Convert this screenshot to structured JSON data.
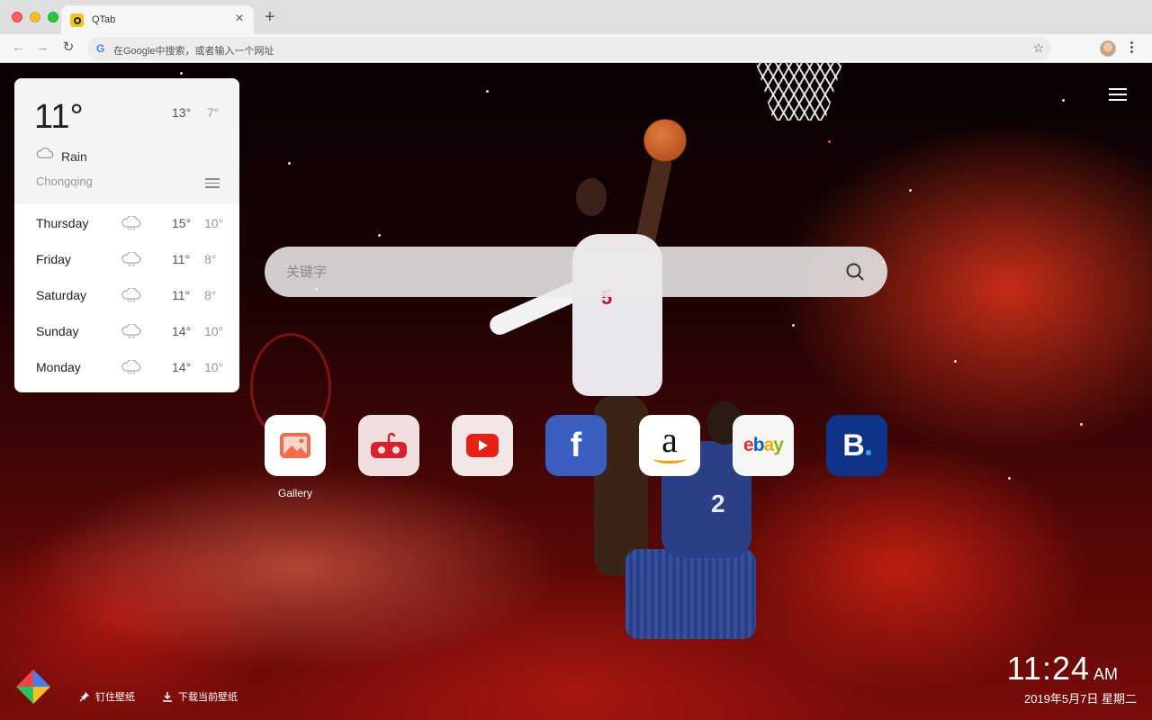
{
  "browser": {
    "tab_title": "QTab",
    "tab_close": "×",
    "new_tab": "+",
    "omnibox_placeholder": "在Google中搜索，或者输入一个网址",
    "back": "←",
    "forward": "→",
    "reload": "↻",
    "star": "☆"
  },
  "weather": {
    "current_temp": "11°",
    "high": "13°",
    "low": "7°",
    "condition": "Rain",
    "city": "Chongqing",
    "forecast": [
      {
        "day": "Thursday",
        "high": "15°",
        "low": "10°"
      },
      {
        "day": "Friday",
        "high": "11°",
        "low": "8°"
      },
      {
        "day": "Saturday",
        "high": "11°",
        "low": "8°"
      },
      {
        "day": "Sunday",
        "high": "14°",
        "low": "10°"
      },
      {
        "day": "Monday",
        "high": "14°",
        "low": "10°"
      }
    ]
  },
  "search": {
    "placeholder": "关键字"
  },
  "shortcuts": [
    {
      "name": "gallery",
      "label": "Gallery",
      "icon": "image-icon"
    },
    {
      "name": "game",
      "label": "",
      "icon": "gamepad-icon"
    },
    {
      "name": "youtube",
      "label": "",
      "icon": "youtube-icon"
    },
    {
      "name": "facebook",
      "label": "",
      "icon": "facebook-icon",
      "glyph": "f"
    },
    {
      "name": "amazon",
      "label": "",
      "icon": "amazon-icon",
      "glyph": "a"
    },
    {
      "name": "ebay",
      "label": "",
      "icon": "ebay-icon",
      "letters": [
        "e",
        "b",
        "a",
        "y"
      ]
    },
    {
      "name": "booking",
      "label": "",
      "icon": "booking-icon",
      "glyph": "B"
    }
  ],
  "bottom": {
    "pin_wallpaper": "钉住壁纸",
    "download_wallpaper": "下载当前壁纸",
    "time": "11:24",
    "ampm": "AM",
    "date": "2019年5月7日  星期二"
  },
  "colors": {
    "youtube_red": "#e62117",
    "facebook_blue": "#3a5ec0",
    "booking_blue": "#10338a",
    "ebay_e": "#e53238",
    "ebay_b": "#0064d2",
    "ebay_a": "#f5af02",
    "ebay_y": "#86b817"
  }
}
